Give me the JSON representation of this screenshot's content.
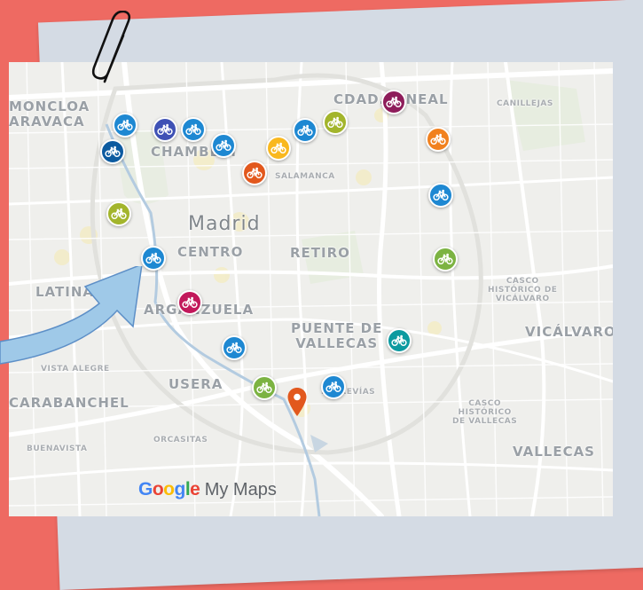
{
  "map": {
    "labels": [
      {
        "id": "moncloa",
        "lines": [
          "MONCLOA",
          "ARAVACA"
        ]
      },
      {
        "id": "ciudad-lineal",
        "lines": [
          "CDAD. LINEAL"
        ]
      },
      {
        "id": "canillejas",
        "lines": [
          "CANILLEJAS"
        ]
      },
      {
        "id": "chamberi",
        "lines": [
          "CHAMBERÍ"
        ]
      },
      {
        "id": "salamanca",
        "lines": [
          "SALAMANCA"
        ]
      },
      {
        "id": "madrid",
        "lines": [
          "Madrid"
        ]
      },
      {
        "id": "centro",
        "lines": [
          "CENTRO"
        ]
      },
      {
        "id": "retiro",
        "lines": [
          "RETIRO"
        ]
      },
      {
        "id": "latina",
        "lines": [
          "LATINA"
        ]
      },
      {
        "id": "arganzuela",
        "lines": [
          "ARGANZUELA"
        ]
      },
      {
        "id": "casco-vicalvaro",
        "lines": [
          "CASCO",
          "HISTÓRICO DE",
          "VICÁLVARO"
        ]
      },
      {
        "id": "vicalvaro",
        "lines": [
          "VICÁLVARO"
        ]
      },
      {
        "id": "puente-vallecas",
        "lines": [
          "PUENTE DE",
          "VALLECAS"
        ]
      },
      {
        "id": "vista-alegre",
        "lines": [
          "VISTA ALEGRE"
        ]
      },
      {
        "id": "usera",
        "lines": [
          "USERA"
        ]
      },
      {
        "id": "carabanchel",
        "lines": [
          "CARABANCHEL"
        ]
      },
      {
        "id": "entrevias",
        "lines": [
          "ENTREVÍAS"
        ]
      },
      {
        "id": "casco-vallecas",
        "lines": [
          "CASCO",
          "HISTÓRICO",
          "DE VALLECAS"
        ]
      },
      {
        "id": "buenavista",
        "lines": [
          "BUENAVISTA"
        ]
      },
      {
        "id": "orcasitas",
        "lines": [
          "ORCASITAS"
        ]
      },
      {
        "id": "vallecas",
        "lines": [
          "VALLECAS"
        ]
      }
    ],
    "markers": [
      {
        "icon": "bicycle-icon",
        "color": "#1e88d2"
      },
      {
        "icon": "bicycle-icon",
        "color": "#3f51b5"
      },
      {
        "icon": "bicycle-icon",
        "color": "#1e88d2"
      },
      {
        "icon": "bicycle-icon",
        "color": "#1e88d2"
      },
      {
        "icon": "bicycle-icon",
        "color": "#0d5ba0"
      },
      {
        "icon": "bicycle-icon",
        "color": "#f9b81f"
      },
      {
        "icon": "bicycle-icon",
        "color": "#1e88d2"
      },
      {
        "icon": "bicycle-icon",
        "color": "#a3b52c"
      },
      {
        "icon": "bicycle-icon",
        "color": "#8e1d5b"
      },
      {
        "icon": "bicycle-icon",
        "color": "#f1811e"
      },
      {
        "icon": "bicycle-icon",
        "color": "#e2581d"
      },
      {
        "icon": "bicycle-icon",
        "color": "#1e88d2"
      },
      {
        "icon": "bicycle-icon",
        "color": "#a3b52c"
      },
      {
        "icon": "bicycle-icon",
        "color": "#1e88d2"
      },
      {
        "icon": "bicycle-icon",
        "color": "#7cb342"
      },
      {
        "icon": "bicycle-icon",
        "color": "#c2185b"
      },
      {
        "icon": "bicycle-icon",
        "color": "#0c9aa0"
      },
      {
        "icon": "bicycle-icon",
        "color": "#1e88d2"
      },
      {
        "icon": "bicycle-icon",
        "color": "#7cb342"
      },
      {
        "icon": "bicycle-icon",
        "color": "#1e88d2"
      }
    ],
    "pin": {
      "icon": "map-pin-icon",
      "color": "#e2581d"
    }
  },
  "logo": {
    "letters": [
      {
        "char": "G",
        "color": "#4285f4"
      },
      {
        "char": "o",
        "color": "#ea4335"
      },
      {
        "char": "o",
        "color": "#fbbc05"
      },
      {
        "char": "g",
        "color": "#4285f4"
      },
      {
        "char": "l",
        "color": "#34a853"
      },
      {
        "char": "e",
        "color": "#ea4335"
      }
    ],
    "suffix": "My Maps"
  },
  "decor": {
    "background_color": "#ee6a62",
    "card_color": "#d4dbe4",
    "arrow_color": "#9fc9e8"
  }
}
